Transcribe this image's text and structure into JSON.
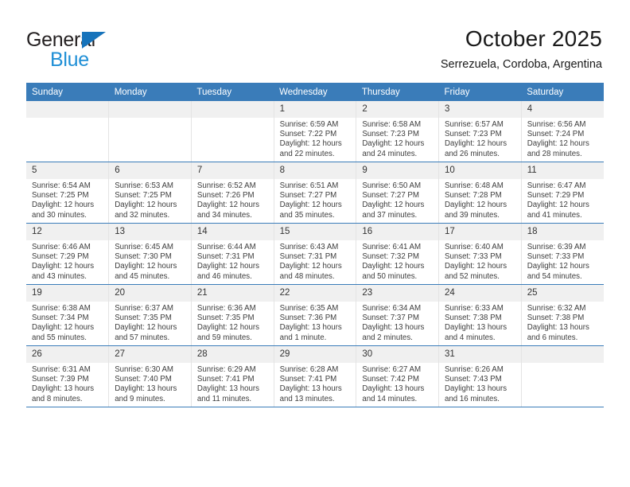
{
  "brand": {
    "name_top": "General",
    "name_bottom": "Blue",
    "triangle_icon": "triangle-icon",
    "color_dark": "#231f20",
    "color_blue": "#1f8fd6"
  },
  "header": {
    "title": "October 2025",
    "subtitle": "Serrezuela, Cordoba, Argentina"
  },
  "theme": {
    "header_bg": "#3a7cb9",
    "daynum_bg": "#f0f0f0",
    "cell_bg": "#ffffff",
    "row_border": "#3a7cb9"
  },
  "calendar": {
    "weekday_headers": [
      "Sunday",
      "Monday",
      "Tuesday",
      "Wednesday",
      "Thursday",
      "Friday",
      "Saturday"
    ],
    "labels": {
      "sunrise": "Sunrise:",
      "sunset": "Sunset:",
      "daylight": "Daylight:"
    },
    "weeks": [
      [
        {
          "day": "",
          "empty": true
        },
        {
          "day": "",
          "empty": true
        },
        {
          "day": "",
          "empty": true
        },
        {
          "day": "1",
          "sunrise": "Sunrise: 6:59 AM",
          "sunset": "Sunset: 7:22 PM",
          "daylight_1": "Daylight: 12 hours",
          "daylight_2": "and 22 minutes."
        },
        {
          "day": "2",
          "sunrise": "Sunrise: 6:58 AM",
          "sunset": "Sunset: 7:23 PM",
          "daylight_1": "Daylight: 12 hours",
          "daylight_2": "and 24 minutes."
        },
        {
          "day": "3",
          "sunrise": "Sunrise: 6:57 AM",
          "sunset": "Sunset: 7:23 PM",
          "daylight_1": "Daylight: 12 hours",
          "daylight_2": "and 26 minutes."
        },
        {
          "day": "4",
          "sunrise": "Sunrise: 6:56 AM",
          "sunset": "Sunset: 7:24 PM",
          "daylight_1": "Daylight: 12 hours",
          "daylight_2": "and 28 minutes."
        }
      ],
      [
        {
          "day": "5",
          "sunrise": "Sunrise: 6:54 AM",
          "sunset": "Sunset: 7:25 PM",
          "daylight_1": "Daylight: 12 hours",
          "daylight_2": "and 30 minutes."
        },
        {
          "day": "6",
          "sunrise": "Sunrise: 6:53 AM",
          "sunset": "Sunset: 7:25 PM",
          "daylight_1": "Daylight: 12 hours",
          "daylight_2": "and 32 minutes."
        },
        {
          "day": "7",
          "sunrise": "Sunrise: 6:52 AM",
          "sunset": "Sunset: 7:26 PM",
          "daylight_1": "Daylight: 12 hours",
          "daylight_2": "and 34 minutes."
        },
        {
          "day": "8",
          "sunrise": "Sunrise: 6:51 AM",
          "sunset": "Sunset: 7:27 PM",
          "daylight_1": "Daylight: 12 hours",
          "daylight_2": "and 35 minutes."
        },
        {
          "day": "9",
          "sunrise": "Sunrise: 6:50 AM",
          "sunset": "Sunset: 7:27 PM",
          "daylight_1": "Daylight: 12 hours",
          "daylight_2": "and 37 minutes."
        },
        {
          "day": "10",
          "sunrise": "Sunrise: 6:48 AM",
          "sunset": "Sunset: 7:28 PM",
          "daylight_1": "Daylight: 12 hours",
          "daylight_2": "and 39 minutes."
        },
        {
          "day": "11",
          "sunrise": "Sunrise: 6:47 AM",
          "sunset": "Sunset: 7:29 PM",
          "daylight_1": "Daylight: 12 hours",
          "daylight_2": "and 41 minutes."
        }
      ],
      [
        {
          "day": "12",
          "sunrise": "Sunrise: 6:46 AM",
          "sunset": "Sunset: 7:29 PM",
          "daylight_1": "Daylight: 12 hours",
          "daylight_2": "and 43 minutes."
        },
        {
          "day": "13",
          "sunrise": "Sunrise: 6:45 AM",
          "sunset": "Sunset: 7:30 PM",
          "daylight_1": "Daylight: 12 hours",
          "daylight_2": "and 45 minutes."
        },
        {
          "day": "14",
          "sunrise": "Sunrise: 6:44 AM",
          "sunset": "Sunset: 7:31 PM",
          "daylight_1": "Daylight: 12 hours",
          "daylight_2": "and 46 minutes."
        },
        {
          "day": "15",
          "sunrise": "Sunrise: 6:43 AM",
          "sunset": "Sunset: 7:31 PM",
          "daylight_1": "Daylight: 12 hours",
          "daylight_2": "and 48 minutes."
        },
        {
          "day": "16",
          "sunrise": "Sunrise: 6:41 AM",
          "sunset": "Sunset: 7:32 PM",
          "daylight_1": "Daylight: 12 hours",
          "daylight_2": "and 50 minutes."
        },
        {
          "day": "17",
          "sunrise": "Sunrise: 6:40 AM",
          "sunset": "Sunset: 7:33 PM",
          "daylight_1": "Daylight: 12 hours",
          "daylight_2": "and 52 minutes."
        },
        {
          "day": "18",
          "sunrise": "Sunrise: 6:39 AM",
          "sunset": "Sunset: 7:33 PM",
          "daylight_1": "Daylight: 12 hours",
          "daylight_2": "and 54 minutes."
        }
      ],
      [
        {
          "day": "19",
          "sunrise": "Sunrise: 6:38 AM",
          "sunset": "Sunset: 7:34 PM",
          "daylight_1": "Daylight: 12 hours",
          "daylight_2": "and 55 minutes."
        },
        {
          "day": "20",
          "sunrise": "Sunrise: 6:37 AM",
          "sunset": "Sunset: 7:35 PM",
          "daylight_1": "Daylight: 12 hours",
          "daylight_2": "and 57 minutes."
        },
        {
          "day": "21",
          "sunrise": "Sunrise: 6:36 AM",
          "sunset": "Sunset: 7:35 PM",
          "daylight_1": "Daylight: 12 hours",
          "daylight_2": "and 59 minutes."
        },
        {
          "day": "22",
          "sunrise": "Sunrise: 6:35 AM",
          "sunset": "Sunset: 7:36 PM",
          "daylight_1": "Daylight: 13 hours",
          "daylight_2": "and 1 minute."
        },
        {
          "day": "23",
          "sunrise": "Sunrise: 6:34 AM",
          "sunset": "Sunset: 7:37 PM",
          "daylight_1": "Daylight: 13 hours",
          "daylight_2": "and 2 minutes."
        },
        {
          "day": "24",
          "sunrise": "Sunrise: 6:33 AM",
          "sunset": "Sunset: 7:38 PM",
          "daylight_1": "Daylight: 13 hours",
          "daylight_2": "and 4 minutes."
        },
        {
          "day": "25",
          "sunrise": "Sunrise: 6:32 AM",
          "sunset": "Sunset: 7:38 PM",
          "daylight_1": "Daylight: 13 hours",
          "daylight_2": "and 6 minutes."
        }
      ],
      [
        {
          "day": "26",
          "sunrise": "Sunrise: 6:31 AM",
          "sunset": "Sunset: 7:39 PM",
          "daylight_1": "Daylight: 13 hours",
          "daylight_2": "and 8 minutes."
        },
        {
          "day": "27",
          "sunrise": "Sunrise: 6:30 AM",
          "sunset": "Sunset: 7:40 PM",
          "daylight_1": "Daylight: 13 hours",
          "daylight_2": "and 9 minutes."
        },
        {
          "day": "28",
          "sunrise": "Sunrise: 6:29 AM",
          "sunset": "Sunset: 7:41 PM",
          "daylight_1": "Daylight: 13 hours",
          "daylight_2": "and 11 minutes."
        },
        {
          "day": "29",
          "sunrise": "Sunrise: 6:28 AM",
          "sunset": "Sunset: 7:41 PM",
          "daylight_1": "Daylight: 13 hours",
          "daylight_2": "and 13 minutes."
        },
        {
          "day": "30",
          "sunrise": "Sunrise: 6:27 AM",
          "sunset": "Sunset: 7:42 PM",
          "daylight_1": "Daylight: 13 hours",
          "daylight_2": "and 14 minutes."
        },
        {
          "day": "31",
          "sunrise": "Sunrise: 6:26 AM",
          "sunset": "Sunset: 7:43 PM",
          "daylight_1": "Daylight: 13 hours",
          "daylight_2": "and 16 minutes."
        },
        {
          "day": "",
          "empty": true
        }
      ]
    ]
  }
}
